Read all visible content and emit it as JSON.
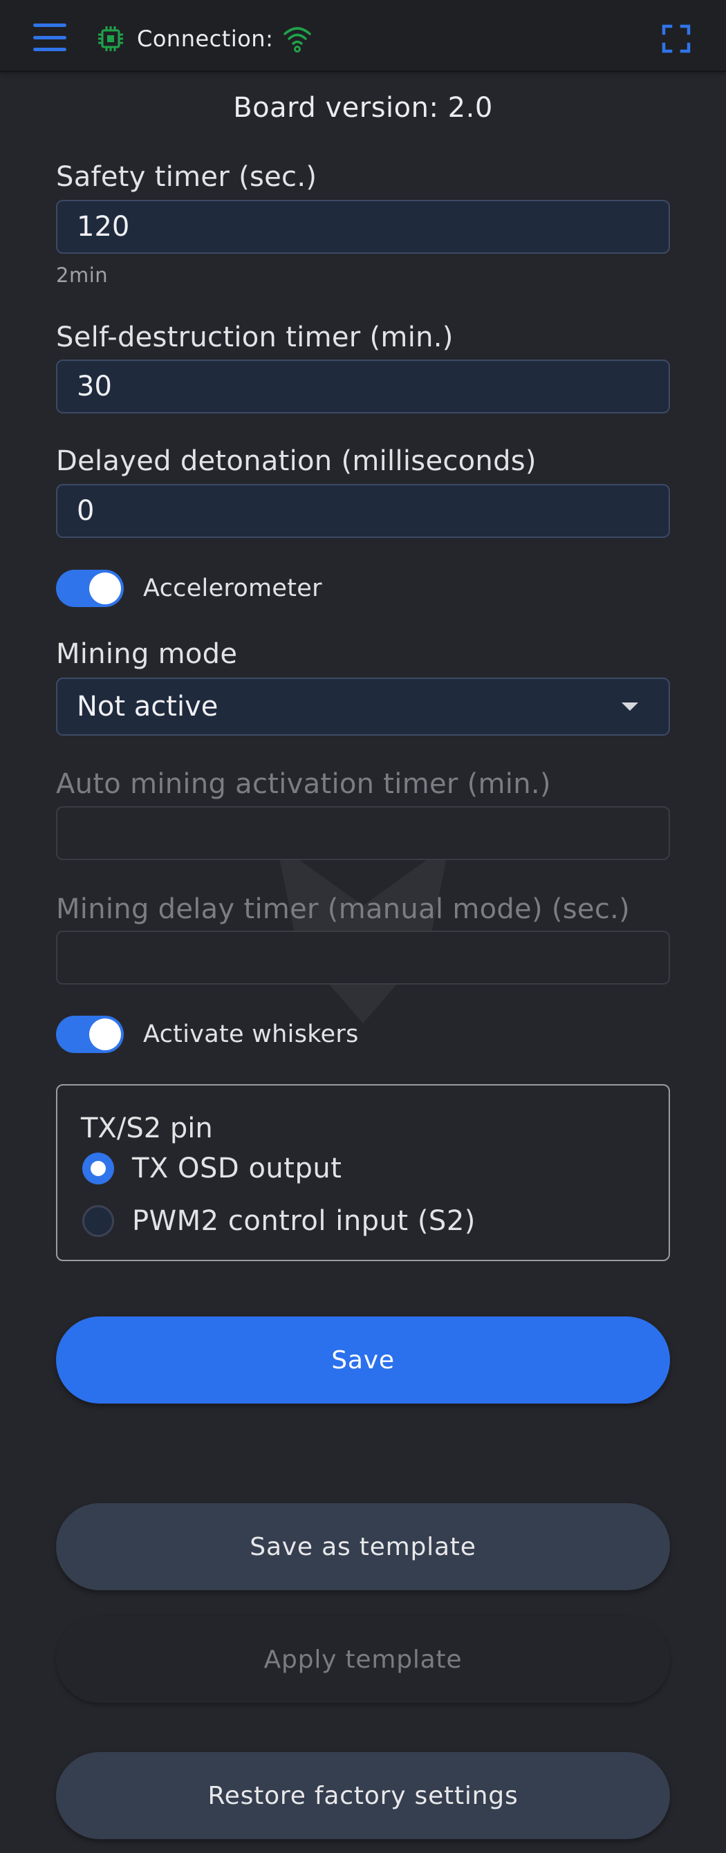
{
  "header": {
    "menu_icon": "hamburger-menu-icon",
    "chip_icon": "chip-icon",
    "connection_label": "Connection:",
    "connection_icon": "wifi-icon",
    "connection_color": "#1fa34a",
    "fullscreen_icon": "fullscreen-icon",
    "accent_color": "#2f74ea"
  },
  "board_version": "Board version: 2.0",
  "form": {
    "safety_timer": {
      "label": "Safety timer (sec.)",
      "value": "120",
      "hint": "2min"
    },
    "self_destruction_timer": {
      "label": "Self-destruction timer (min.)",
      "value": "30"
    },
    "delayed_detonation": {
      "label": "Delayed detonation (milliseconds)",
      "value": "0"
    },
    "accelerometer": {
      "label": "Accelerometer",
      "enabled": true
    },
    "mining_mode": {
      "label": "Mining mode",
      "value": "Not active"
    },
    "auto_mining_timer": {
      "label": "Auto mining activation timer (min.)",
      "value": "",
      "disabled": true
    },
    "mining_delay_timer": {
      "label": "Mining delay timer (manual mode) (sec.)",
      "value": "",
      "disabled": true
    },
    "whiskers": {
      "label": "Activate whiskers",
      "enabled": true
    },
    "tx_s2_pin": {
      "legend": "TX/S2 pin",
      "options": [
        {
          "label": "TX OSD output",
          "selected": true
        },
        {
          "label": "PWM2 control input (S2)",
          "selected": false
        }
      ]
    }
  },
  "buttons": {
    "save": "Save",
    "save_as_template": "Save as template",
    "apply_template": "Apply template",
    "restore_factory": "Restore factory settings"
  }
}
